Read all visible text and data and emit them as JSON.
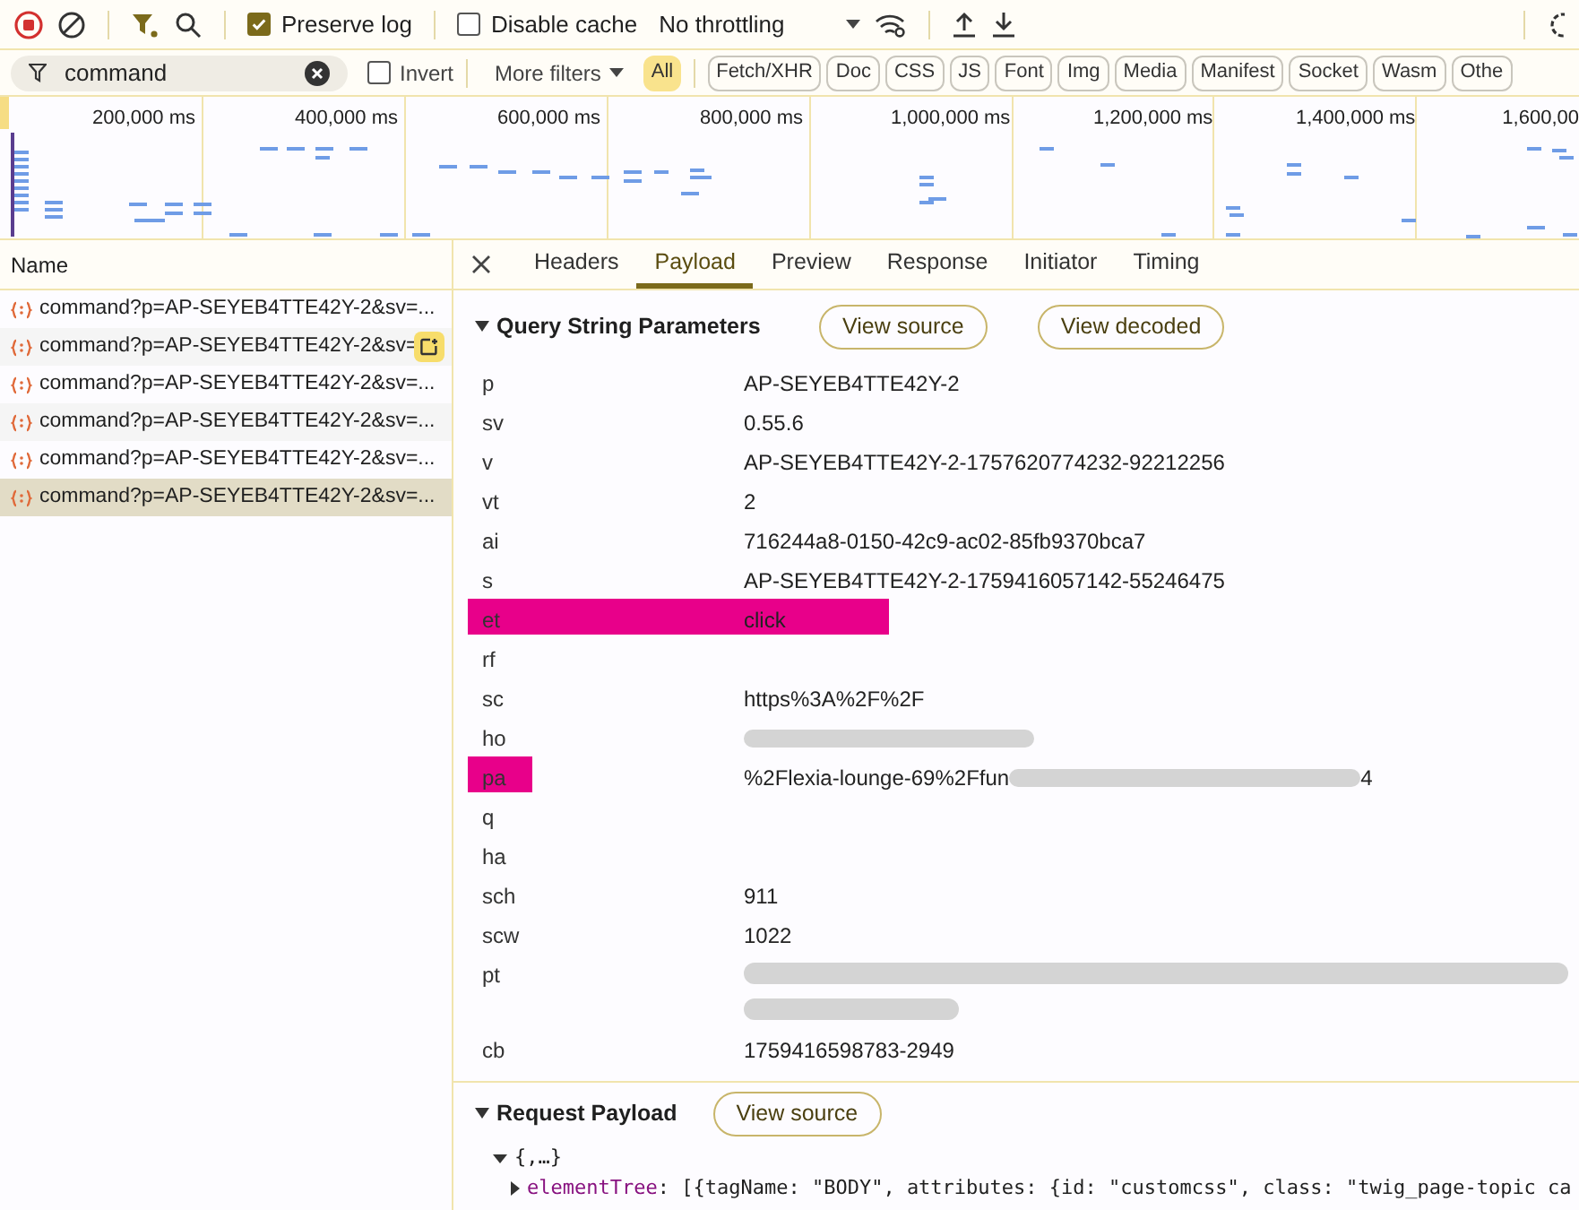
{
  "toolbar": {
    "preserve_log": {
      "label": "Preserve log",
      "checked": true
    },
    "disable_cache": {
      "label": "Disable cache",
      "checked": false
    },
    "throttling": "No throttling"
  },
  "filter_bar": {
    "value": "command",
    "invert": {
      "label": "Invert",
      "checked": false
    },
    "more_filters": "More filters",
    "types": [
      {
        "label": "All",
        "selected": true
      },
      {
        "label": "Fetch/XHR",
        "selected": false
      },
      {
        "label": "Doc",
        "selected": false
      },
      {
        "label": "CSS",
        "selected": false
      },
      {
        "label": "JS",
        "selected": false
      },
      {
        "label": "Font",
        "selected": false
      },
      {
        "label": "Img",
        "selected": false
      },
      {
        "label": "Media",
        "selected": false
      },
      {
        "label": "Manifest",
        "selected": false
      },
      {
        "label": "Socket",
        "selected": false
      },
      {
        "label": "Wasm",
        "selected": false
      },
      {
        "label": "Othe",
        "selected": false
      }
    ]
  },
  "timeline": {
    "ticks": [
      "200,000 ms",
      "400,000 ms",
      "600,000 ms",
      "800,000 ms",
      "1,000,000 ms",
      "1,200,000 ms",
      "1,400,000 ms",
      "1,600,00"
    ]
  },
  "requests": {
    "column": "Name",
    "rows": [
      {
        "name": "command?p=AP-SEYEB4TTE42Y-2&sv=...",
        "selected": false
      },
      {
        "name": "command?p=AP-SEYEB4TTE42Y-2&sv=",
        "selected": false,
        "hovered": true
      },
      {
        "name": "command?p=AP-SEYEB4TTE42Y-2&sv=...",
        "selected": false
      },
      {
        "name": "command?p=AP-SEYEB4TTE42Y-2&sv=...",
        "selected": false
      },
      {
        "name": "command?p=AP-SEYEB4TTE42Y-2&sv=...",
        "selected": false
      },
      {
        "name": "command?p=AP-SEYEB4TTE42Y-2&sv=...",
        "selected": true
      }
    ]
  },
  "detail": {
    "tabs": [
      {
        "label": "Headers",
        "selected": false
      },
      {
        "label": "Payload",
        "selected": true
      },
      {
        "label": "Preview",
        "selected": false
      },
      {
        "label": "Response",
        "selected": false
      },
      {
        "label": "Initiator",
        "selected": false
      },
      {
        "label": "Timing",
        "selected": false
      }
    ],
    "query": {
      "title": "Query String Parameters",
      "expanded": true,
      "buttons": [
        "View source",
        "View decoded"
      ],
      "params": [
        {
          "key": "p",
          "value": "AP-SEYEB4TTE42Y-2"
        },
        {
          "key": "sv",
          "value": "0.55.6"
        },
        {
          "key": "v",
          "value": "AP-SEYEB4TTE42Y-2-1757620774232-92212256"
        },
        {
          "key": "vt",
          "value": "2"
        },
        {
          "key": "ai",
          "value": "716244a8-0150-42c9-ac02-85fb9370bca7"
        },
        {
          "key": "s",
          "value": "AP-SEYEB4TTE42Y-2-1759416057142-55246475"
        },
        {
          "key": "et",
          "value": "click",
          "key_highlighted": true,
          "value_highlighted": true
        },
        {
          "key": "rf"
        },
        {
          "key": "sc",
          "value": "https%3A%2F%2F"
        },
        {
          "key": "ho",
          "kind": "scribbled"
        },
        {
          "key": "pa",
          "value": "%2Flexia-lounge-69%2Ffun",
          "kind": "partial",
          "tail": "4",
          "key_highlighted": true,
          "value_highlighted": false
        },
        {
          "key": "q"
        },
        {
          "key": "ha"
        },
        {
          "key": "sch",
          "value": "911"
        },
        {
          "key": "scw",
          "value": "1022"
        },
        {
          "key": "pt",
          "kind": "double"
        },
        {
          "key": "cb",
          "value": "1759416598783-2949"
        }
      ]
    },
    "payload": {
      "title": "Request Payload",
      "expanded": true,
      "button": "View source",
      "root": "{,…}",
      "entry": {
        "key": "elementTree",
        "separator": ":",
        "value": "[{tagName: \"BODY\", attributes: {id: \"customcss\", class: \"twig_page-topic ca"
      }
    }
  }
}
